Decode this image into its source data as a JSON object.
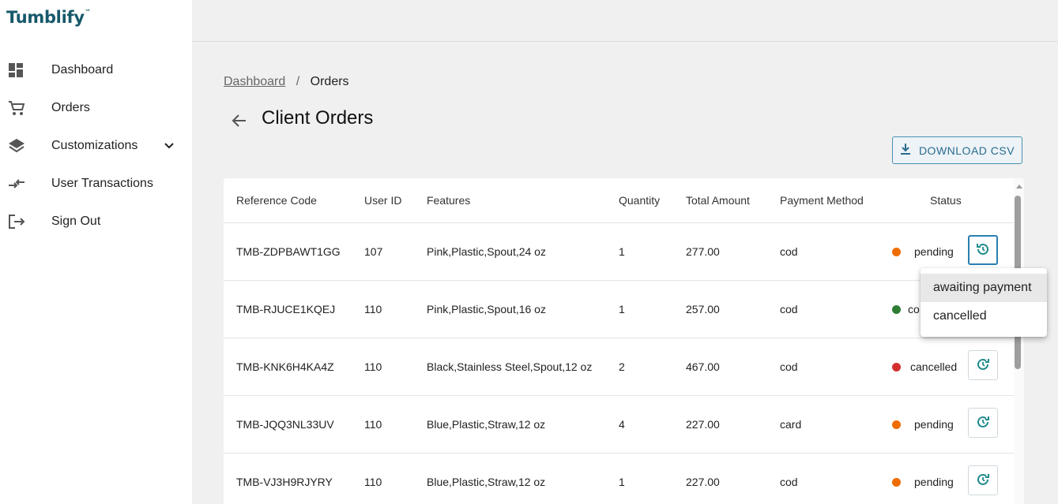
{
  "app": {
    "logo": "Tumblify",
    "logo_mark": "™"
  },
  "sidebar": {
    "items": [
      {
        "label": "Dashboard",
        "icon": "dashboard-icon"
      },
      {
        "label": "Orders",
        "icon": "cart-icon"
      },
      {
        "label": "Customizations",
        "icon": "layers-icon",
        "expandable": true
      },
      {
        "label": "User Transactions",
        "icon": "transactions-icon"
      },
      {
        "label": "Sign Out",
        "icon": "sign-out-icon"
      }
    ]
  },
  "breadcrumb": {
    "link": "Dashboard",
    "separator": "/",
    "current": "Orders"
  },
  "page": {
    "title": "Client Orders"
  },
  "toolbar": {
    "download_label": "DOWNLOAD CSV"
  },
  "table": {
    "columns": [
      "Reference Code",
      "User ID",
      "Features",
      "Quantity",
      "Total Amount",
      "Payment Method",
      "Status"
    ],
    "rows": [
      {
        "ref": "TMB-ZDPBAWT1GG",
        "user_id": "107",
        "features": "Pink,Plastic,Spout,24 oz",
        "quantity": "1",
        "total": "277.00",
        "payment": "cod",
        "status": "pending",
        "status_color": "#ef6c00"
      },
      {
        "ref": "TMB-RJUCE1KQEJ",
        "user_id": "110",
        "features": "Pink,Plastic,Spout,16 oz",
        "quantity": "1",
        "total": "257.00",
        "payment": "cod",
        "status": "co",
        "status_color": "#2e7d32"
      },
      {
        "ref": "TMB-KNK6H4KA4Z",
        "user_id": "110",
        "features": "Black,Stainless Steel,Spout,12 oz",
        "quantity": "2",
        "total": "467.00",
        "payment": "cod",
        "status": "cancelled",
        "status_color": "#d32f2f"
      },
      {
        "ref": "TMB-JQQ3NL33UV",
        "user_id": "110",
        "features": "Blue,Plastic,Straw,12 oz",
        "quantity": "4",
        "total": "227.00",
        "payment": "card",
        "status": "pending",
        "status_color": "#ef6c00"
      },
      {
        "ref": "TMB-VJ3H9RJYRY",
        "user_id": "110",
        "features": "Blue,Plastic,Straw,12 oz",
        "quantity": "1",
        "total": "227.00",
        "payment": "cod",
        "status": "pending",
        "status_color": "#ef6c00"
      }
    ]
  },
  "status_menu": {
    "options": [
      "awaiting payment",
      "cancelled"
    ],
    "highlighted": "awaiting payment"
  },
  "colors": {
    "accent": "#2a7fb1",
    "teal": "#17596b",
    "pending": "#ef6c00",
    "completed": "#2e7d32",
    "cancelled": "#d32f2f"
  }
}
